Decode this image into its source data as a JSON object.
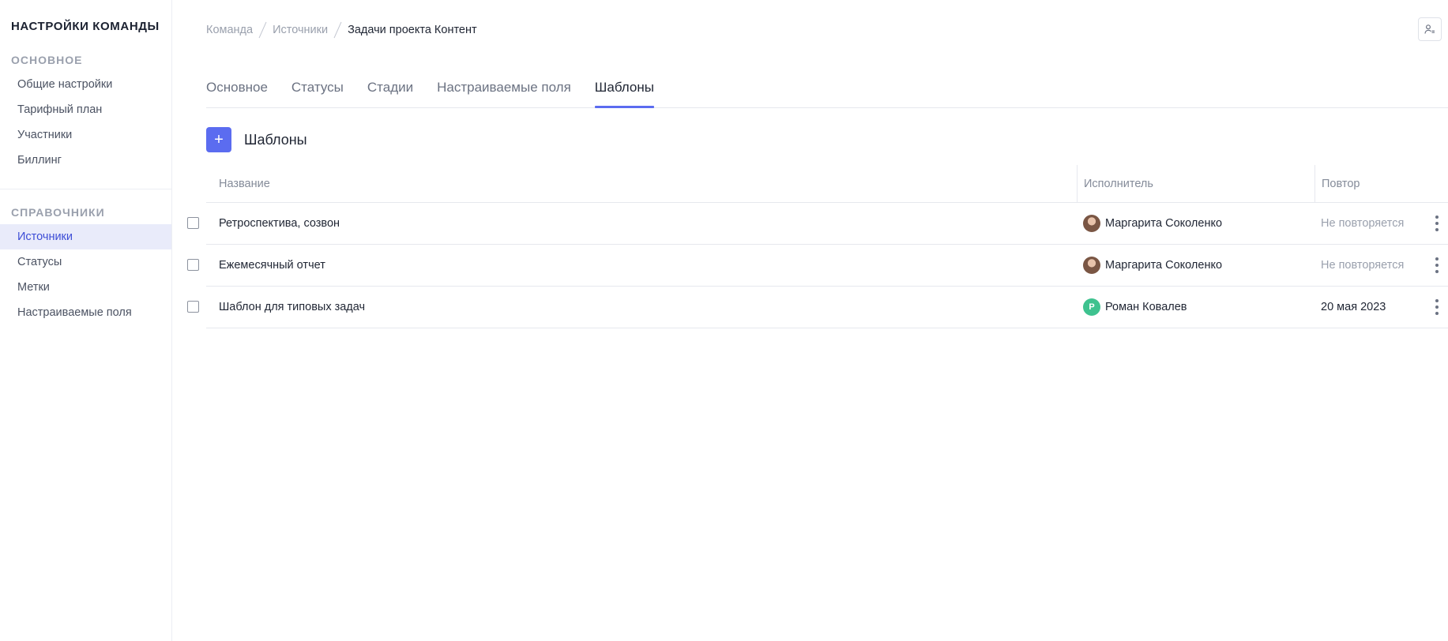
{
  "sidebar": {
    "title": "НАСТРОЙКИ КОМАНДЫ",
    "sections": [
      {
        "title": "ОСНОВНОЕ",
        "items": [
          {
            "label": "Общие настройки"
          },
          {
            "label": "Тарифный план"
          },
          {
            "label": "Участники"
          },
          {
            "label": "Биллинг"
          }
        ]
      },
      {
        "title": "СПРАВОЧНИКИ",
        "items": [
          {
            "label": "Источники",
            "active": true
          },
          {
            "label": "Статусы"
          },
          {
            "label": "Метки"
          },
          {
            "label": "Настраиваемые поля"
          }
        ]
      }
    ]
  },
  "breadcrumb": {
    "items": [
      "Команда",
      "Источники",
      "Задачи проекта Контент"
    ]
  },
  "header": {
    "user_icon": "user-settings-icon"
  },
  "tabs": [
    {
      "label": "Основное"
    },
    {
      "label": "Статусы"
    },
    {
      "label": "Стадии"
    },
    {
      "label": "Настраиваемые поля"
    },
    {
      "label": "Шаблоны",
      "active": true
    }
  ],
  "toolbar": {
    "add_icon": "plus-icon",
    "add_symbol": "+",
    "title": "Шаблоны"
  },
  "table": {
    "columns": [
      "Название",
      "Исполнитель",
      "Повтор"
    ],
    "rows": [
      {
        "name": "Ретроспектива, созвон",
        "assignee": "Маргарита Соколенко",
        "repeat": "Не повторяется"
      },
      {
        "name": "Ежемесячный отчет",
        "assignee": "Маргарита Соколенко",
        "repeat": "Не повторяется"
      },
      {
        "name": "Шаблон для типовых задач",
        "assignee": "Роман Ковалев",
        "assignee_initial": "Р",
        "repeat": "20 мая 2023"
      }
    ]
  },
  "colors": {
    "accent": "#5b6cf0",
    "active_nav_bg": "#e9ebfa",
    "avatar_green": "#3ec28f"
  }
}
